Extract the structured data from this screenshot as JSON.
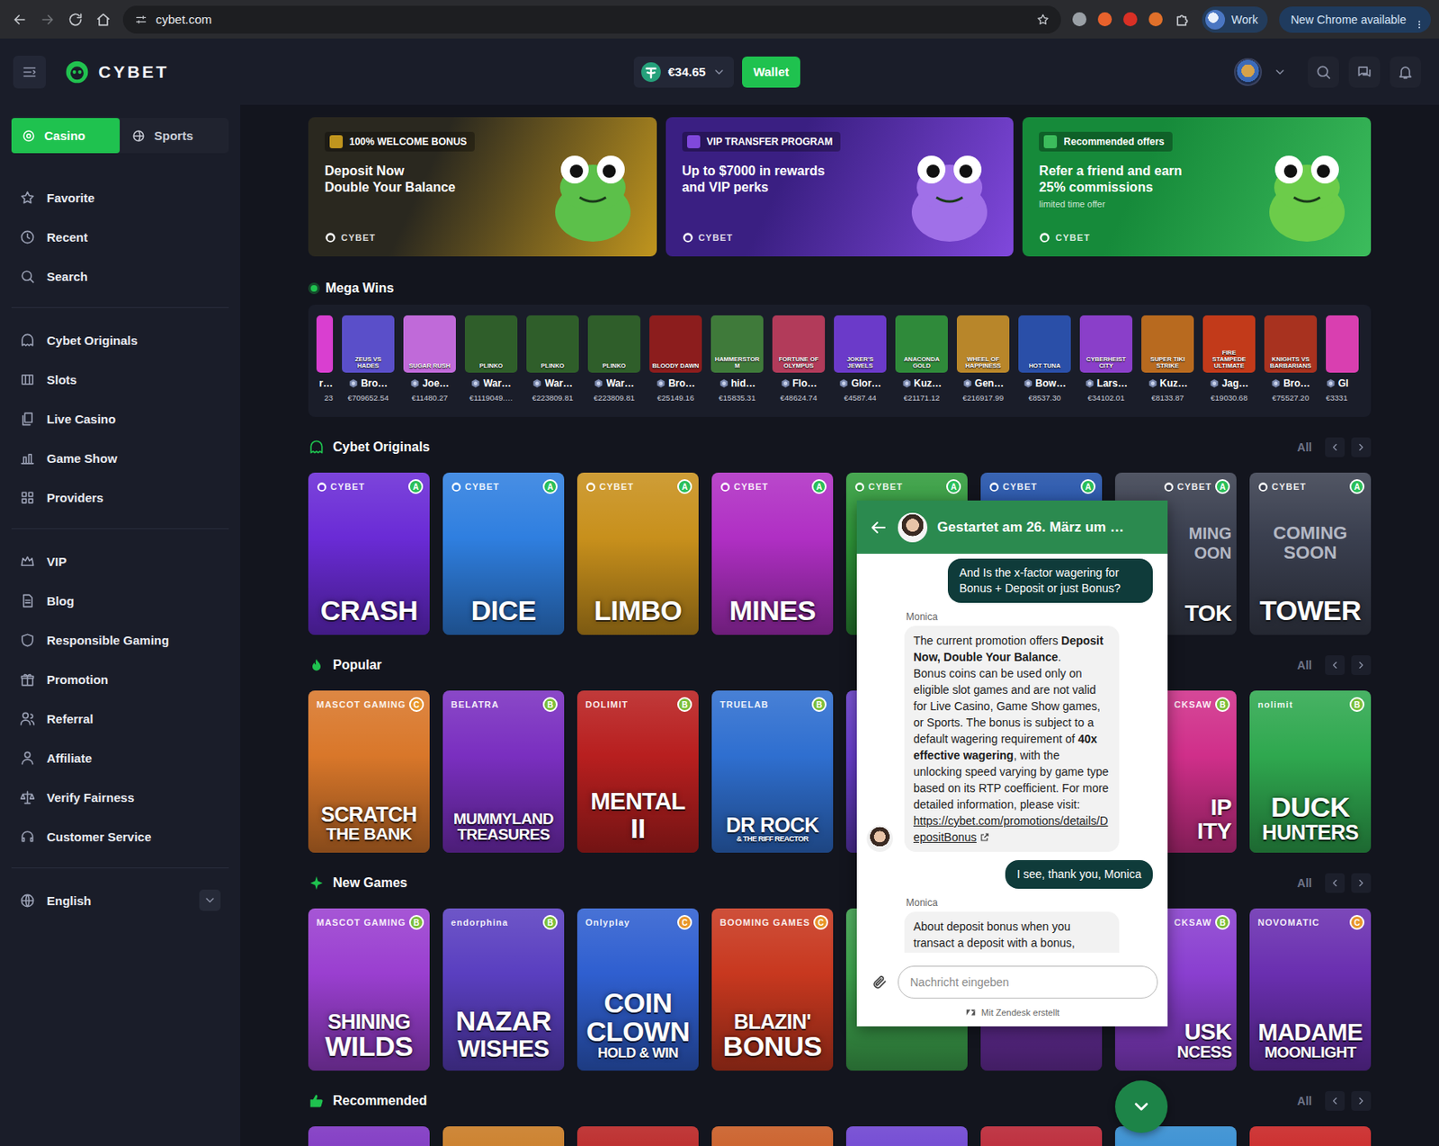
{
  "browser": {
    "url": "cybet.com",
    "profile": "Work",
    "update": "New Chrome available"
  },
  "header": {
    "logo": "CYBET",
    "balance": "€34.65",
    "wallet": "Wallet"
  },
  "sidebar": {
    "tabs": [
      {
        "label": "Casino",
        "selected": true
      },
      {
        "label": "Sports",
        "selected": false
      }
    ],
    "groups": [
      [
        {
          "label": "Favorite"
        },
        {
          "label": "Recent"
        },
        {
          "label": "Search"
        }
      ],
      [
        {
          "label": "Cybet Originals"
        },
        {
          "label": "Slots"
        },
        {
          "label": "Live Casino"
        },
        {
          "label": "Game Show"
        },
        {
          "label": "Providers"
        }
      ],
      [
        {
          "label": "VIP"
        },
        {
          "label": "Blog"
        },
        {
          "label": "Responsible Gaming"
        },
        {
          "label": "Promotion"
        },
        {
          "label": "Referral"
        },
        {
          "label": "Affiliate"
        },
        {
          "label": "Verify Fairness"
        },
        {
          "label": "Customer Service"
        }
      ]
    ],
    "language": "English"
  },
  "banners": [
    {
      "chip": "100% WELCOME BONUS",
      "lines": [
        "Deposit Now",
        "Double Your Balance"
      ],
      "brand": "CYBET",
      "color": "#2a281f",
      "accent": "#c0951e"
    },
    {
      "chip": "VIP TRANSFER PROGRAM",
      "lines": [
        "Up to $7000 in rewards",
        "and VIP perks"
      ],
      "brand": "CYBET",
      "color": "#3a1f82",
      "accent": "#8048dc"
    },
    {
      "chip": "Recommended offers",
      "lines": [
        "Refer a friend and earn",
        "25% commissions"
      ],
      "note": "limited time offer",
      "brand": "CYBET",
      "color": "#168a3a",
      "accent": "#3cbc5c"
    }
  ],
  "carousel": [
    {
      "selected": false
    },
    {
      "selected": false
    },
    {
      "selected": false
    },
    {
      "selected": true
    },
    {
      "selected": false
    },
    {
      "selected": false
    }
  ],
  "megaWins": {
    "title": "Mega Wins",
    "tiles": [
      {
        "kind": "cut-left",
        "player": "r…",
        "amount": "23",
        "color": "#d93fd0"
      },
      {
        "kind": "full",
        "game": "ZEUS VS HADES",
        "player": "Bro…",
        "amount": "€709652.54",
        "color": "#5a4fc9"
      },
      {
        "kind": "full",
        "game": "SUGAR RUSH",
        "player": "Joe…",
        "amount": "€11480.27",
        "color": "#c06ad9"
      },
      {
        "kind": "full",
        "game": "PLINKO",
        "player": "War…",
        "amount": "€1119049.…",
        "color": "#2f5e2a"
      },
      {
        "kind": "full",
        "game": "PLINKO",
        "player": "War…",
        "amount": "€223809.81",
        "color": "#2f5e2a"
      },
      {
        "kind": "full",
        "game": "PLINKO",
        "player": "War…",
        "amount": "€223809.81",
        "color": "#2f5e2a"
      },
      {
        "kind": "full",
        "game": "BLOODY DAWN",
        "player": "Bro…",
        "amount": "€25149.16",
        "color": "#8c1d1d"
      },
      {
        "kind": "full",
        "game": "HAMMERSTORM",
        "player": "hid…",
        "amount": "€15835.31",
        "color": "#3f7a3a"
      },
      {
        "kind": "full",
        "game": "FORTUNE OF OLYMPUS",
        "player": "Flo…",
        "amount": "€48624.74",
        "color": "#b23b5a"
      },
      {
        "kind": "full",
        "game": "JOKER'S JEWELS",
        "player": "Glor…",
        "amount": "€4587.44",
        "color": "#6b3ac9"
      },
      {
        "kind": "full",
        "game": "ANACONDA GOLD",
        "player": "Kuz…",
        "amount": "€21171.12",
        "color": "#2f8a3a"
      },
      {
        "kind": "full",
        "game": "WHEEL OF HAPPINESS",
        "player": "Gen…",
        "amount": "€216917.99",
        "color": "#b8862a"
      },
      {
        "kind": "full",
        "game": "HOT TUNA",
        "player": "Bow…",
        "amount": "€8537.30",
        "color": "#2a4fa8"
      },
      {
        "kind": "full",
        "game": "CYBERHEIST CITY",
        "player": "Lars…",
        "amount": "€34102.01",
        "color": "#8a3fc9"
      },
      {
        "kind": "full",
        "game": "SUPER TIKI STRIKE",
        "player": "Kuz…",
        "amount": "€8133.87",
        "color": "#b86a1f"
      },
      {
        "kind": "full",
        "game": "FIRE STAMPEDE ULTIMATE",
        "player": "Jag…",
        "amount": "€19030.68",
        "color": "#c23a1a"
      },
      {
        "kind": "full",
        "game": "KNIGHTS VS BARBARIANS",
        "player": "Bro…",
        "amount": "€75527.20",
        "color": "#a8321f"
      },
      {
        "kind": "cut-right",
        "player": "Gl",
        "amount": "€3331",
        "color": "#d93fb0"
      }
    ]
  },
  "sections": [
    {
      "title": "Cybet Originals",
      "all": "All",
      "cards": [
        {
          "kind": "full",
          "provider": "CYBET",
          "badge": {
            "text": "A",
            "color": "#2bbf5a"
          },
          "title": [
            "CRASH"
          ],
          "color": "#6a2bd6"
        },
        {
          "kind": "full",
          "provider": "CYBET",
          "badge": {
            "text": "A",
            "color": "#2bbf5a"
          },
          "title": [
            "DICE"
          ],
          "color": "#2f7fe0"
        },
        {
          "kind": "full",
          "provider": "CYBET",
          "badge": {
            "text": "A",
            "color": "#2bbf5a"
          },
          "title": [
            "LIMBO"
          ],
          "color": "#c8901c"
        },
        {
          "kind": "full",
          "provider": "CYBET",
          "badge": {
            "text": "A",
            "color": "#2bbf5a"
          },
          "title": [
            "MINES"
          ],
          "color": "#b02fc4"
        },
        {
          "kind": "covered",
          "provider": "CYBET",
          "badge": {
            "text": "A",
            "color": "#2bbf5a"
          },
          "color": "#2f9a3a"
        },
        {
          "kind": "covered",
          "provider": "CYBET",
          "badge": {
            "text": "A",
            "color": "#2bbf5a"
          },
          "color": "#1f4fa8"
        },
        {
          "kind": "partial",
          "provider": "CYBET",
          "badge": {
            "text": "A",
            "color": "#2bbf5a"
          },
          "soon": [
            "MING",
            "OON"
          ],
          "title": [
            "TOK"
          ],
          "color": "#3a3f4f"
        },
        {
          "kind": "full",
          "provider": "CYBET",
          "badge": {
            "text": "A",
            "color": "#2bbf5a"
          },
          "soon": [
            "COMING",
            "SOON"
          ],
          "title": [
            "TOWER"
          ],
          "color": "#3a3f4f"
        }
      ]
    },
    {
      "title": "Popular",
      "all": "All",
      "cards": [
        {
          "kind": "full",
          "provider": "MASCOT GAMING",
          "badge": {
            "text": "C",
            "color": "#e8962a"
          },
          "title": [
            "SCRATCH",
            "THE BANK"
          ],
          "color": "#d9772a"
        },
        {
          "kind": "full",
          "provider": "BELATRA",
          "badge": {
            "text": "B",
            "color": "#7cbf3a"
          },
          "title": [
            "MUMMYLAND",
            "TREASURES"
          ],
          "color": "#7a2fc0"
        },
        {
          "kind": "full",
          "provider": "DOLIMIT",
          "badge": {
            "text": "B",
            "color": "#7cbf3a"
          },
          "title": [
            "MENTAL",
            "II"
          ],
          "color": "#b81f1f"
        },
        {
          "kind": "full",
          "provider": "TRUELAB",
          "badge": {
            "text": "B",
            "color": "#7cbf3a"
          },
          "title": [
            "DR ROCK",
            "& THE RIFF REACTOR"
          ],
          "color": "#2f6fd0"
        },
        {
          "kind": "covered",
          "color": "#6a3fd0"
        },
        {
          "kind": "covered",
          "color": "#3a2f8a"
        },
        {
          "kind": "partial",
          "provider": "CKSAW",
          "badge": {
            "text": "B",
            "color": "#7cbf3a"
          },
          "title": [
            "IP",
            "ITY"
          ],
          "color": "#d02f8a"
        },
        {
          "kind": "full",
          "provider": "nolimit",
          "badge": {
            "text": "B",
            "color": "#7cbf3a"
          },
          "title": [
            "DUCK",
            "HUNTERS"
          ],
          "color": "#2fa84f"
        }
      ]
    },
    {
      "title": "New Games",
      "all": "All",
      "cards": [
        {
          "kind": "full",
          "provider": "MASCOT GAMING",
          "badge": {
            "text": "B",
            "color": "#7cbf3a"
          },
          "title": [
            "SHINING",
            "WILDS"
          ],
          "color": "#9a3fd0"
        },
        {
          "kind": "full",
          "provider": "endorphina",
          "badge": {
            "text": "B",
            "color": "#7cbf3a"
          },
          "title": [
            "NAZAR",
            "WISHES"
          ],
          "color": "#5a3fc0"
        },
        {
          "kind": "full",
          "provider": "Onlyplay",
          "badge": {
            "text": "C",
            "color": "#e8962a"
          },
          "title": [
            "COIN",
            "CLOWN",
            "HOLD & WIN"
          ],
          "color": "#2f5fd0"
        },
        {
          "kind": "full",
          "provider": "BOOMING GAMES",
          "badge": {
            "text": "C",
            "color": "#e8962a"
          },
          "title": [
            "BLAZIN'",
            "BONUS"
          ],
          "color": "#c8381f"
        },
        {
          "kind": "covered",
          "color": "#3fa84f"
        },
        {
          "kind": "covered",
          "color": "#6a2fa0"
        },
        {
          "kind": "partial",
          "provider": "CKSAW",
          "badge": {
            "text": "B",
            "color": "#7cbf3a"
          },
          "title": [
            "USK",
            "NCESS"
          ],
          "color": "#8a3fd0"
        },
        {
          "kind": "full",
          "provider": "NOVOMATIC",
          "badge": {
            "text": "C",
            "color": "#e8962a"
          },
          "title": [
            "MADAME",
            "MOONLIGHT"
          ],
          "color": "#6a2fb0"
        }
      ]
    },
    {
      "title": "Recommended",
      "all": "All",
      "cards": [
        {
          "kind": "cut",
          "color": "#7a2fc0"
        },
        {
          "kind": "cut",
          "color": "#c8781f"
        },
        {
          "kind": "cut",
          "color": "#b81f1f"
        },
        {
          "kind": "cut",
          "color": "#c8581f"
        },
        {
          "kind": "cut",
          "color": "#6a3fd0"
        },
        {
          "kind": "cut",
          "color": "#b81f2f"
        },
        {
          "kind": "cut",
          "color": "#2f8ad0"
        },
        {
          "kind": "cut",
          "color": "#c81f1f"
        }
      ]
    }
  ],
  "chat": {
    "title": "Gestartet am 26. März um …",
    "messages": [
      {
        "from": "user",
        "text": "And Is the x-factor wagering for Bonus + Deposit or just Bonus?"
      },
      {
        "from": "agent",
        "sender": "Monica",
        "avatar": true,
        "cut": false,
        "paragraphs": [
          [
            {
              "text": "The current promotion offers ",
              "bold": false
            },
            {
              "text": "Deposit Now, Double Your Balance",
              "bold": true
            },
            {
              "text": ".",
              "bold": false
            }
          ],
          [
            {
              "text": "Bonus coins can be used only on eligible slot games and are not valid for Live Casino, Game Show games, or Sports. The bonus is subject to a default wagering requirement of ",
              "bold": false
            },
            {
              "text": "40x effective wagering",
              "bold": true
            },
            {
              "text": ", with the unlocking speed varying by game type based on its RTP coefficient. For more detailed information, please visit:",
              "bold": false
            }
          ]
        ],
        "link": "https://cybet.com/promotions/details/DepositBonus"
      },
      {
        "from": "user",
        "text": "I see, thank you, Monica"
      },
      {
        "from": "agent",
        "sender": "Monica",
        "avatar": false,
        "cut": true,
        "paragraphs": [
          [
            {
              "text": "About deposit bonus when you transact a deposit with a bonus,",
              "bold": false
            }
          ]
        ]
      }
    ],
    "placeholder": "Nachricht eingeben",
    "footer": "Mit Zendesk erstellt"
  }
}
